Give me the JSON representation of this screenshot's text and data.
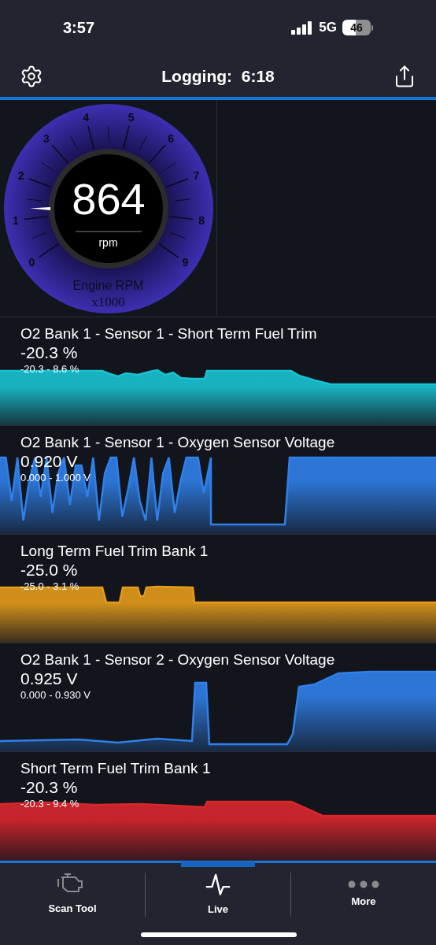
{
  "status_bar": {
    "time": "3:57",
    "network": "5G",
    "battery": "46"
  },
  "header": {
    "title": "Logging:  6:18"
  },
  "gauge": {
    "value": "864",
    "unit": "rpm",
    "label": "Engine RPM",
    "scale": "x1000",
    "ticks": [
      "0",
      "1",
      "2",
      "3",
      "4",
      "5",
      "6",
      "7",
      "8",
      "9"
    ]
  },
  "panels": [
    {
      "title": "O2 Bank 1 - Sensor 1 - Short Term Fuel Trim",
      "value": "-20.3 %",
      "range": "-20.3 - 8.6 %",
      "color": "#19c3d3"
    },
    {
      "title": "O2 Bank 1 - Sensor 1 - Oxygen Sensor Voltage",
      "value": "0.920 V",
      "range": "0.000 - 1.000 V",
      "color": "#2f80ea"
    },
    {
      "title": "Long Term Fuel Trim Bank 1",
      "value": "-25.0 %",
      "range": "-25.0 - 3.1 %",
      "color": "#e49b1a"
    },
    {
      "title": "O2 Bank 1 - Sensor 2 - Oxygen Sensor Voltage",
      "value": "0.925 V",
      "range": "0.000 - 0.930 V",
      "color": "#2f80ea"
    },
    {
      "title": "Short Term Fuel Trim Bank 1",
      "value": "-20.3 %",
      "range": "-20.3 - 9.4 %",
      "color": "#d9262c"
    }
  ],
  "tabs": [
    {
      "label": "Scan Tool",
      "selected": false
    },
    {
      "label": "Live",
      "selected": true
    },
    {
      "label": "More",
      "selected": false
    }
  ]
}
